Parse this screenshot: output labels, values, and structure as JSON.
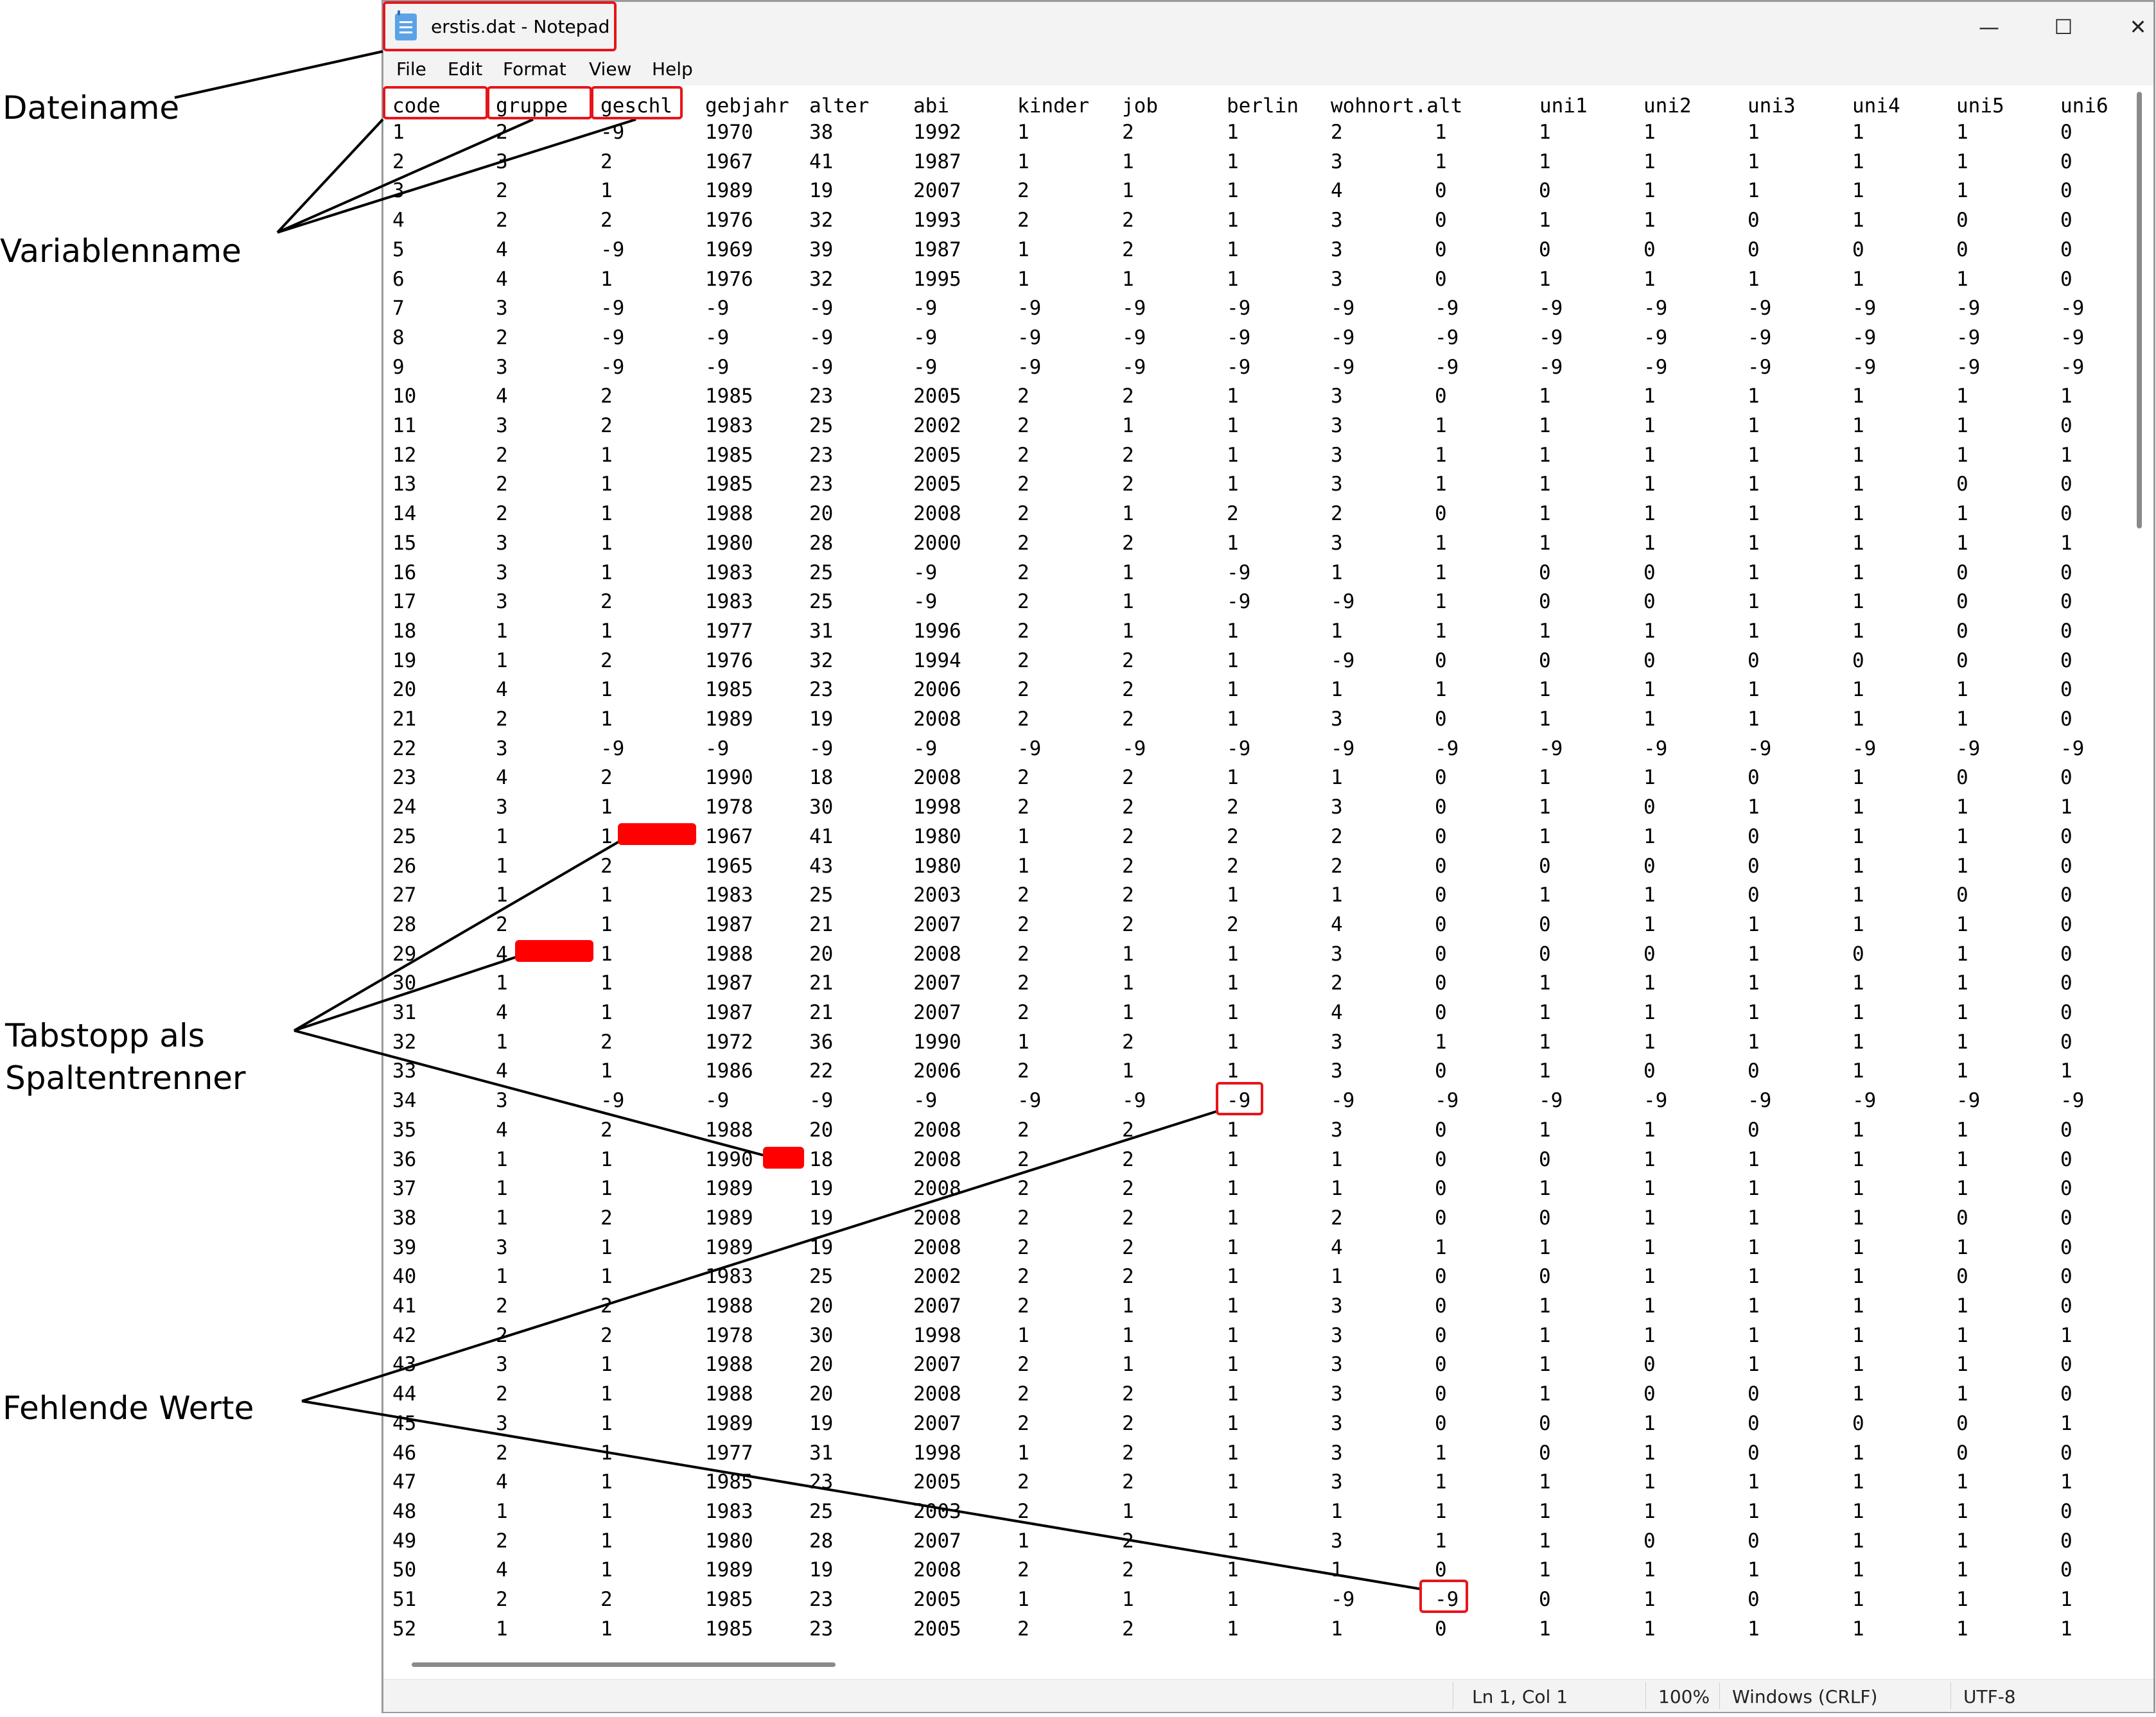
{
  "window": {
    "title": "erstis.dat - Notepad",
    "controls": {
      "minimize": "—",
      "maximize": "☐",
      "close": "✕"
    }
  },
  "menu": [
    "File",
    "Edit",
    "Format",
    "View",
    "Help"
  ],
  "columns": [
    "code",
    "gruppe",
    "geschl",
    "gebjahr",
    "alter",
    "abi",
    "kinder",
    "job",
    "berlin",
    "wohnort.alt",
    "uni1",
    "uni2",
    "uni3",
    "uni4",
    "uni5",
    "uni6"
  ],
  "rows": [
    [
      "1",
      "2",
      "-9",
      "1970",
      "38",
      "1992",
      "1",
      "2",
      "1",
      "2",
      "1",
      "1",
      "1",
      "1",
      "1",
      "1",
      "0"
    ],
    [
      "2",
      "3",
      "2",
      "1967",
      "41",
      "1987",
      "1",
      "1",
      "1",
      "3",
      "1",
      "1",
      "1",
      "1",
      "1",
      "1",
      "0"
    ],
    [
      "3",
      "2",
      "1",
      "1989",
      "19",
      "2007",
      "2",
      "1",
      "1",
      "4",
      "0",
      "0",
      "1",
      "1",
      "1",
      "1",
      "0"
    ],
    [
      "4",
      "2",
      "2",
      "1976",
      "32",
      "1993",
      "2",
      "2",
      "1",
      "3",
      "0",
      "1",
      "1",
      "0",
      "1",
      "0",
      "0"
    ],
    [
      "5",
      "4",
      "-9",
      "1969",
      "39",
      "1987",
      "1",
      "2",
      "1",
      "3",
      "0",
      "0",
      "0",
      "0",
      "0",
      "0",
      "0"
    ],
    [
      "6",
      "4",
      "1",
      "1976",
      "32",
      "1995",
      "1",
      "1",
      "1",
      "3",
      "0",
      "1",
      "1",
      "1",
      "1",
      "1",
      "0"
    ],
    [
      "7",
      "3",
      "-9",
      "-9",
      "-9",
      "-9",
      "-9",
      "-9",
      "-9",
      "-9",
      "-9",
      "-9",
      "-9",
      "-9",
      "-9",
      "-9",
      "-9"
    ],
    [
      "8",
      "2",
      "-9",
      "-9",
      "-9",
      "-9",
      "-9",
      "-9",
      "-9",
      "-9",
      "-9",
      "-9",
      "-9",
      "-9",
      "-9",
      "-9",
      "-9"
    ],
    [
      "9",
      "3",
      "-9",
      "-9",
      "-9",
      "-9",
      "-9",
      "-9",
      "-9",
      "-9",
      "-9",
      "-9",
      "-9",
      "-9",
      "-9",
      "-9",
      "-9"
    ],
    [
      "10",
      "4",
      "2",
      "1985",
      "23",
      "2005",
      "2",
      "2",
      "1",
      "3",
      "0",
      "1",
      "1",
      "1",
      "1",
      "1",
      "1"
    ],
    [
      "11",
      "3",
      "2",
      "1983",
      "25",
      "2002",
      "2",
      "1",
      "1",
      "3",
      "1",
      "1",
      "1",
      "1",
      "1",
      "1",
      "0"
    ],
    [
      "12",
      "2",
      "1",
      "1985",
      "23",
      "2005",
      "2",
      "2",
      "1",
      "3",
      "1",
      "1",
      "1",
      "1",
      "1",
      "1",
      "1"
    ],
    [
      "13",
      "2",
      "1",
      "1985",
      "23",
      "2005",
      "2",
      "2",
      "1",
      "3",
      "1",
      "1",
      "1",
      "1",
      "1",
      "0",
      "0"
    ],
    [
      "14",
      "2",
      "1",
      "1988",
      "20",
      "2008",
      "2",
      "1",
      "2",
      "2",
      "0",
      "1",
      "1",
      "1",
      "1",
      "1",
      "0"
    ],
    [
      "15",
      "3",
      "1",
      "1980",
      "28",
      "2000",
      "2",
      "2",
      "1",
      "3",
      "1",
      "1",
      "1",
      "1",
      "1",
      "1",
      "1"
    ],
    [
      "16",
      "3",
      "1",
      "1983",
      "25",
      "-9",
      "2",
      "1",
      "-9",
      "1",
      "1",
      "0",
      "0",
      "1",
      "1",
      "0",
      "0"
    ],
    [
      "17",
      "3",
      "2",
      "1983",
      "25",
      "-9",
      "2",
      "1",
      "-9",
      "-9",
      "1",
      "0",
      "0",
      "1",
      "1",
      "0",
      "0"
    ],
    [
      "18",
      "1",
      "1",
      "1977",
      "31",
      "1996",
      "2",
      "1",
      "1",
      "1",
      "1",
      "1",
      "1",
      "1",
      "1",
      "0",
      "0"
    ],
    [
      "19",
      "1",
      "2",
      "1976",
      "32",
      "1994",
      "2",
      "2",
      "1",
      "-9",
      "0",
      "0",
      "0",
      "0",
      "0",
      "0",
      "0"
    ],
    [
      "20",
      "4",
      "1",
      "1985",
      "23",
      "2006",
      "2",
      "2",
      "1",
      "1",
      "1",
      "1",
      "1",
      "1",
      "1",
      "1",
      "0"
    ],
    [
      "21",
      "2",
      "1",
      "1989",
      "19",
      "2008",
      "2",
      "2",
      "1",
      "3",
      "0",
      "1",
      "1",
      "1",
      "1",
      "1",
      "0"
    ],
    [
      "22",
      "3",
      "-9",
      "-9",
      "-9",
      "-9",
      "-9",
      "-9",
      "-9",
      "-9",
      "-9",
      "-9",
      "-9",
      "-9",
      "-9",
      "-9",
      "-9"
    ],
    [
      "23",
      "4",
      "2",
      "1990",
      "18",
      "2008",
      "2",
      "2",
      "1",
      "1",
      "0",
      "1",
      "1",
      "0",
      "1",
      "0",
      "0"
    ],
    [
      "24",
      "3",
      "1",
      "1978",
      "30",
      "1998",
      "2",
      "2",
      "2",
      "3",
      "0",
      "1",
      "0",
      "1",
      "1",
      "1",
      "1"
    ],
    [
      "25",
      "1",
      "1",
      "1967",
      "41",
      "1980",
      "1",
      "2",
      "2",
      "2",
      "0",
      "1",
      "1",
      "0",
      "1",
      "1",
      "0"
    ],
    [
      "26",
      "1",
      "2",
      "1965",
      "43",
      "1980",
      "1",
      "2",
      "2",
      "2",
      "0",
      "0",
      "0",
      "0",
      "1",
      "1",
      "0"
    ],
    [
      "27",
      "1",
      "1",
      "1983",
      "25",
      "2003",
      "2",
      "2",
      "1",
      "1",
      "0",
      "1",
      "1",
      "0",
      "1",
      "0",
      "0"
    ],
    [
      "28",
      "2",
      "1",
      "1987",
      "21",
      "2007",
      "2",
      "2",
      "2",
      "4",
      "0",
      "0",
      "1",
      "1",
      "1",
      "1",
      "0"
    ],
    [
      "29",
      "4",
      "1",
      "1988",
      "20",
      "2008",
      "2",
      "1",
      "1",
      "3",
      "0",
      "0",
      "0",
      "1",
      "0",
      "1",
      "0"
    ],
    [
      "30",
      "1",
      "1",
      "1987",
      "21",
      "2007",
      "2",
      "1",
      "1",
      "2",
      "0",
      "1",
      "1",
      "1",
      "1",
      "1",
      "0"
    ],
    [
      "31",
      "4",
      "1",
      "1987",
      "21",
      "2007",
      "2",
      "1",
      "1",
      "4",
      "0",
      "1",
      "1",
      "1",
      "1",
      "1",
      "0"
    ],
    [
      "32",
      "1",
      "2",
      "1972",
      "36",
      "1990",
      "1",
      "2",
      "1",
      "3",
      "1",
      "1",
      "1",
      "1",
      "1",
      "1",
      "0"
    ],
    [
      "33",
      "4",
      "1",
      "1986",
      "22",
      "2006",
      "2",
      "1",
      "1",
      "3",
      "0",
      "1",
      "0",
      "0",
      "1",
      "1",
      "1"
    ],
    [
      "34",
      "3",
      "-9",
      "-9",
      "-9",
      "-9",
      "-9",
      "-9",
      "-9",
      "-9",
      "-9",
      "-9",
      "-9",
      "-9",
      "-9",
      "-9",
      "-9"
    ],
    [
      "35",
      "4",
      "2",
      "1988",
      "20",
      "2008",
      "2",
      "2",
      "1",
      "3",
      "0",
      "1",
      "1",
      "0",
      "1",
      "1",
      "0"
    ],
    [
      "36",
      "1",
      "1",
      "1990",
      "18",
      "2008",
      "2",
      "2",
      "1",
      "1",
      "0",
      "0",
      "1",
      "1",
      "1",
      "1",
      "0"
    ],
    [
      "37",
      "1",
      "1",
      "1989",
      "19",
      "2008",
      "2",
      "2",
      "1",
      "1",
      "0",
      "1",
      "1",
      "1",
      "1",
      "1",
      "0"
    ],
    [
      "38",
      "1",
      "2",
      "1989",
      "19",
      "2008",
      "2",
      "2",
      "1",
      "2",
      "0",
      "0",
      "1",
      "1",
      "1",
      "0",
      "0"
    ],
    [
      "39",
      "3",
      "1",
      "1989",
      "19",
      "2008",
      "2",
      "2",
      "1",
      "4",
      "1",
      "1",
      "1",
      "1",
      "1",
      "1",
      "0"
    ],
    [
      "40",
      "1",
      "1",
      "1983",
      "25",
      "2002",
      "2",
      "2",
      "1",
      "1",
      "0",
      "0",
      "1",
      "1",
      "1",
      "0",
      "0"
    ],
    [
      "41",
      "2",
      "2",
      "1988",
      "20",
      "2007",
      "2",
      "1",
      "1",
      "3",
      "0",
      "1",
      "1",
      "1",
      "1",
      "1",
      "0"
    ],
    [
      "42",
      "2",
      "2",
      "1978",
      "30",
      "1998",
      "1",
      "1",
      "1",
      "3",
      "0",
      "1",
      "1",
      "1",
      "1",
      "1",
      "1"
    ],
    [
      "43",
      "3",
      "1",
      "1988",
      "20",
      "2007",
      "2",
      "1",
      "1",
      "3",
      "0",
      "1",
      "0",
      "1",
      "1",
      "1",
      "0"
    ],
    [
      "44",
      "2",
      "1",
      "1988",
      "20",
      "2008",
      "2",
      "2",
      "1",
      "3",
      "0",
      "1",
      "0",
      "0",
      "1",
      "1",
      "0"
    ],
    [
      "45",
      "3",
      "1",
      "1989",
      "19",
      "2007",
      "2",
      "2",
      "1",
      "3",
      "0",
      "0",
      "1",
      "0",
      "0",
      "0",
      "1"
    ],
    [
      "46",
      "2",
      "1",
      "1977",
      "31",
      "1998",
      "1",
      "2",
      "1",
      "3",
      "1",
      "0",
      "1",
      "0",
      "1",
      "0",
      "0"
    ],
    [
      "47",
      "4",
      "1",
      "1985",
      "23",
      "2005",
      "2",
      "2",
      "1",
      "3",
      "1",
      "1",
      "1",
      "1",
      "1",
      "1",
      "1"
    ],
    [
      "48",
      "1",
      "1",
      "1983",
      "25",
      "2003",
      "2",
      "1",
      "1",
      "1",
      "1",
      "1",
      "1",
      "1",
      "1",
      "1",
      "0"
    ],
    [
      "49",
      "2",
      "1",
      "1980",
      "28",
      "2007",
      "1",
      "2",
      "1",
      "3",
      "1",
      "1",
      "0",
      "0",
      "1",
      "1",
      "0"
    ],
    [
      "50",
      "4",
      "1",
      "1989",
      "19",
      "2008",
      "2",
      "2",
      "1",
      "1",
      "0",
      "1",
      "1",
      "1",
      "1",
      "1",
      "0"
    ],
    [
      "51",
      "2",
      "2",
      "1985",
      "23",
      "2005",
      "1",
      "1",
      "1",
      "-9",
      "-9",
      "0",
      "1",
      "0",
      "1",
      "1",
      "1"
    ],
    [
      "52",
      "1",
      "1",
      "1985",
      "23",
      "2005",
      "2",
      "2",
      "1",
      "1",
      "0",
      "1",
      "1",
      "1",
      "1",
      "1",
      "1"
    ]
  ],
  "statusbar": {
    "position": "Ln 1, Col 1",
    "zoom": "100%",
    "line_ending": "Windows (CRLF)",
    "encoding": "UTF-8"
  },
  "annotations": {
    "filename": "Dateiname",
    "varname": "Variablenname",
    "tabstop": "Tabstopp als\nSpaltentrenner",
    "missing": "Fehlende Werte"
  },
  "colors": {
    "highlight": "#e8141b",
    "tab_marker": "#ff0000"
  }
}
